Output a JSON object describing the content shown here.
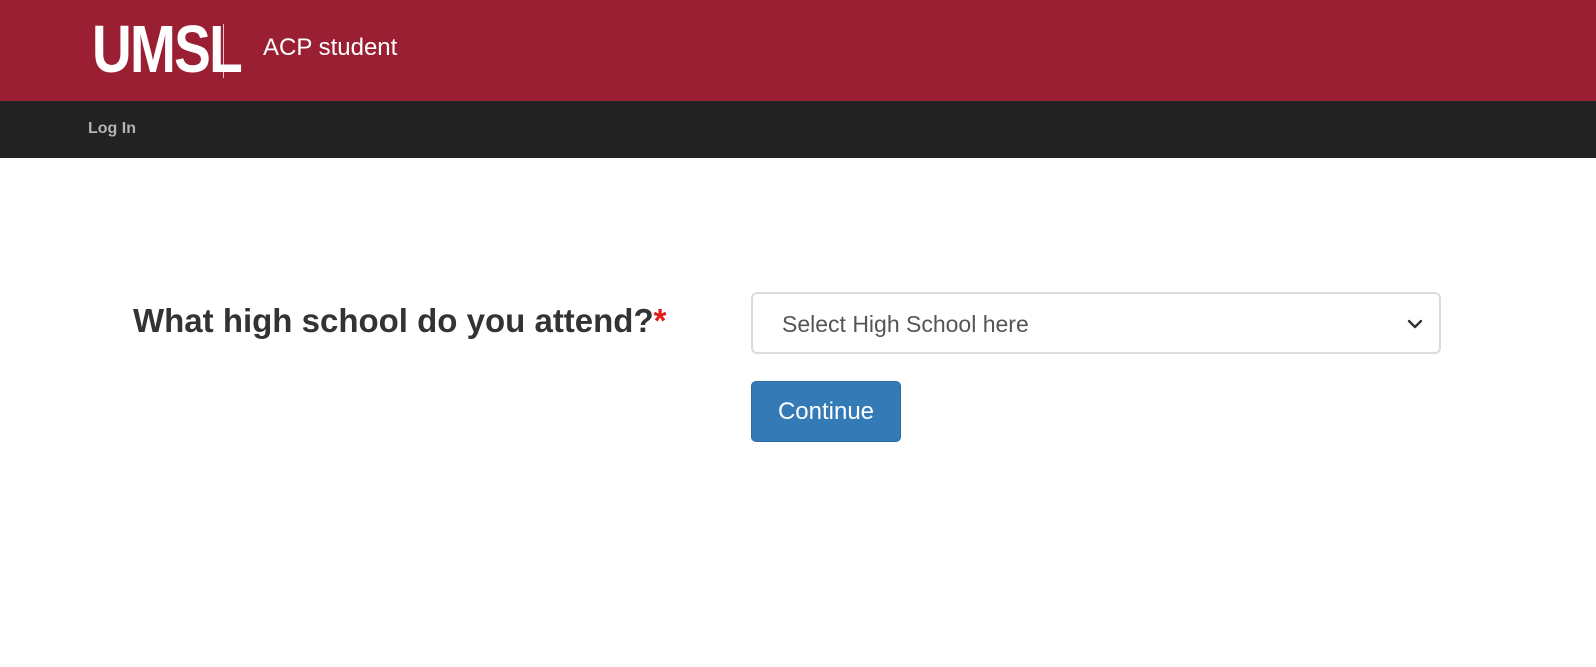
{
  "header": {
    "logo_text": "UMSL",
    "app_title": "ACP student",
    "brand_color": "#9a1f33"
  },
  "nav": {
    "login_label": "Log In",
    "background_color": "#222222"
  },
  "form": {
    "question_label": "What high school do you attend?",
    "required_marker": "*",
    "select": {
      "selected_value": "Select High School here",
      "icon": "chevron-down-icon"
    },
    "continue_label": "Continue",
    "button_color": "#337ab7"
  }
}
